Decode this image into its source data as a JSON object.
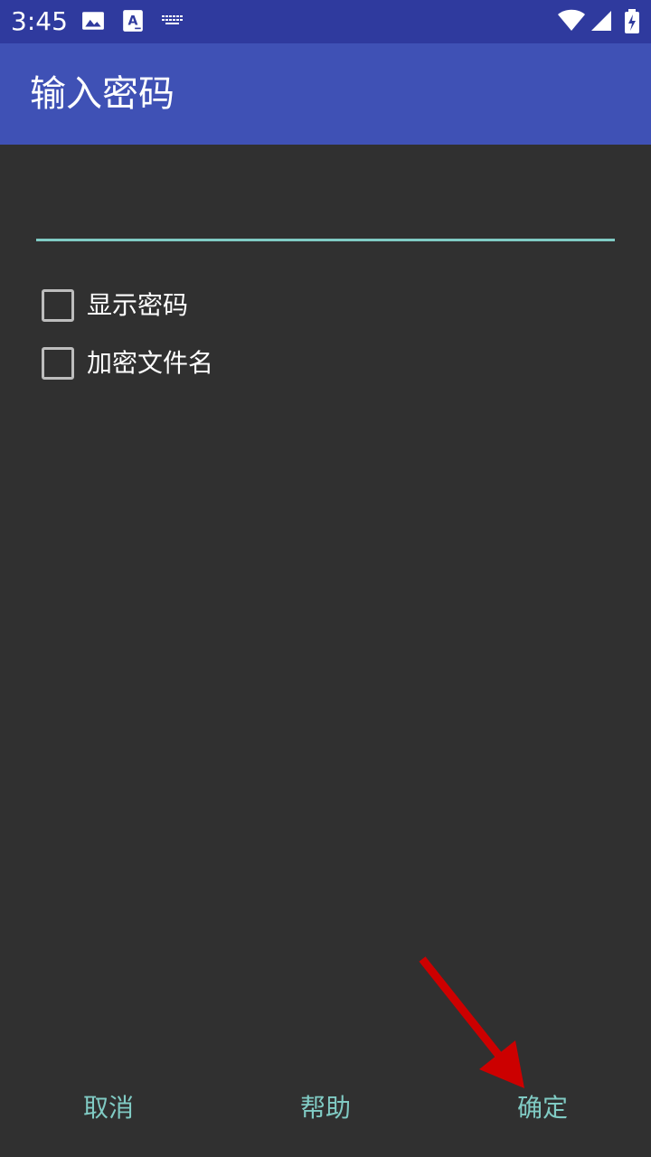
{
  "status_bar": {
    "time": "3:45",
    "icons": [
      "image-icon",
      "text-a-icon",
      "keyboard-icon",
      "wifi-icon",
      "signal-icon",
      "battery-charging-icon"
    ]
  },
  "app_bar": {
    "title": "输入密码"
  },
  "form": {
    "password_value": "",
    "checkboxes": [
      {
        "label": "显示密码",
        "checked": false
      },
      {
        "label": "加密文件名",
        "checked": false
      }
    ]
  },
  "actions": {
    "cancel_label": "取消",
    "help_label": "帮助",
    "ok_label": "确定"
  },
  "colors": {
    "status_bar": "#2f3a9e",
    "app_bar": "#3f51b5",
    "background": "#303030",
    "accent": "#80cbc4",
    "annotation_arrow": "#cc0000"
  }
}
